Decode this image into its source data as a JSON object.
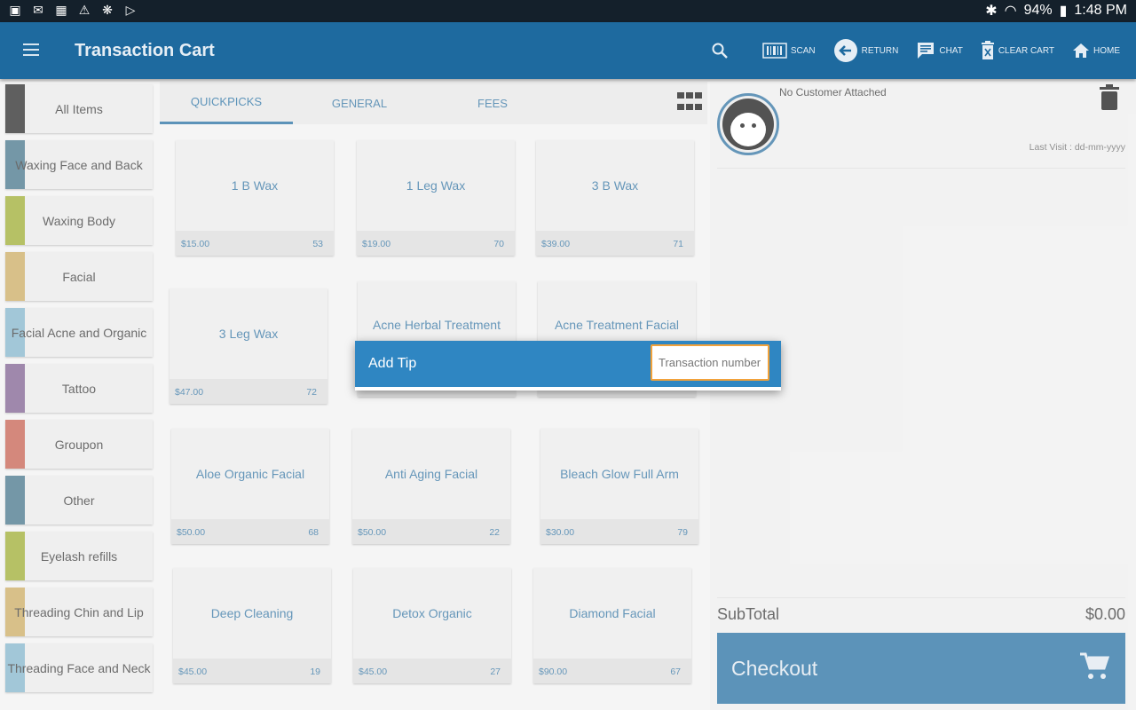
{
  "status_bar": {
    "left_icons": [
      "image-icon",
      "gmail-icon",
      "calendar-icon",
      "warning-icon",
      "cloud-icon",
      "play-store-icon"
    ],
    "battery": "94%",
    "time": "1:48 PM"
  },
  "appbar": {
    "title": "Transaction Cart",
    "actions": [
      {
        "label": "SCAN",
        "icon": "barcode-icon"
      },
      {
        "label": "RETURN",
        "icon": "return-icon"
      },
      {
        "label": "CHAT",
        "icon": "chat-icon"
      },
      {
        "label": "CLEAR CART",
        "icon": "clear-cart-icon"
      },
      {
        "label": "HOME",
        "icon": "home-icon"
      }
    ]
  },
  "categories": [
    {
      "label": "All Items",
      "color": "#222222"
    },
    {
      "label": "Waxing Face and Back",
      "color": "#3f6f86"
    },
    {
      "label": "Waxing Body",
      "color": "#9aa92a"
    },
    {
      "label": "Facial",
      "color": "#c9a85c"
    },
    {
      "label": "Facial Acne and Organic",
      "color": "#7fb2c9"
    },
    {
      "label": "Tattoo",
      "color": "#7a5a8c"
    },
    {
      "label": "Groupon",
      "color": "#c45a4a"
    },
    {
      "label": "Other",
      "color": "#3f6f86"
    },
    {
      "label": "Eyelash refills",
      "color": "#9aa92a"
    },
    {
      "label": "Threading Chin and Lip",
      "color": "#c9a85c"
    },
    {
      "label": "Threading Face and Neck",
      "color": "#7fb2c9"
    }
  ],
  "tabs": [
    {
      "label": "QUICKPICKS",
      "active": true
    },
    {
      "label": "GENERAL",
      "active": false
    },
    {
      "label": "FEES",
      "active": false
    }
  ],
  "products": [
    {
      "name": "1 B Wax",
      "price": "$15.00",
      "count": "53"
    },
    {
      "name": "1 Leg Wax",
      "price": "$19.00",
      "count": "70"
    },
    {
      "name": "3 B Wax",
      "price": "$39.00",
      "count": "71"
    },
    {
      "name": "3 Leg Wax",
      "price": "$47.00",
      "count": "72"
    },
    {
      "name": "Acne Herbal Treatment",
      "price": "",
      "count": ""
    },
    {
      "name": "Acne Treatment Facial",
      "price": "",
      "count": ""
    },
    {
      "name": "Aloe Organic Facial",
      "price": "$50.00",
      "count": "68"
    },
    {
      "name": "Anti Aging Facial",
      "price": "$50.00",
      "count": "22"
    },
    {
      "name": "Bleach Glow Full Arm",
      "price": "$30.00",
      "count": "79"
    },
    {
      "name": "Deep Cleaning",
      "price": "$45.00",
      "count": "19"
    },
    {
      "name": "Detox Organic",
      "price": "$45.00",
      "count": "27"
    },
    {
      "name": "Diamond Facial",
      "price": "$90.00",
      "count": "67"
    }
  ],
  "customer": {
    "name": "No Customer Attached",
    "last_visit": "Last Visit : dd-mm-yyyy"
  },
  "cart": {
    "subtotal_label": "SubTotal",
    "subtotal_value": "$0.00",
    "checkout_label": "Checkout"
  },
  "dialog": {
    "title": "Add Tip",
    "input_placeholder": "Transaction number",
    "input_value": ""
  }
}
